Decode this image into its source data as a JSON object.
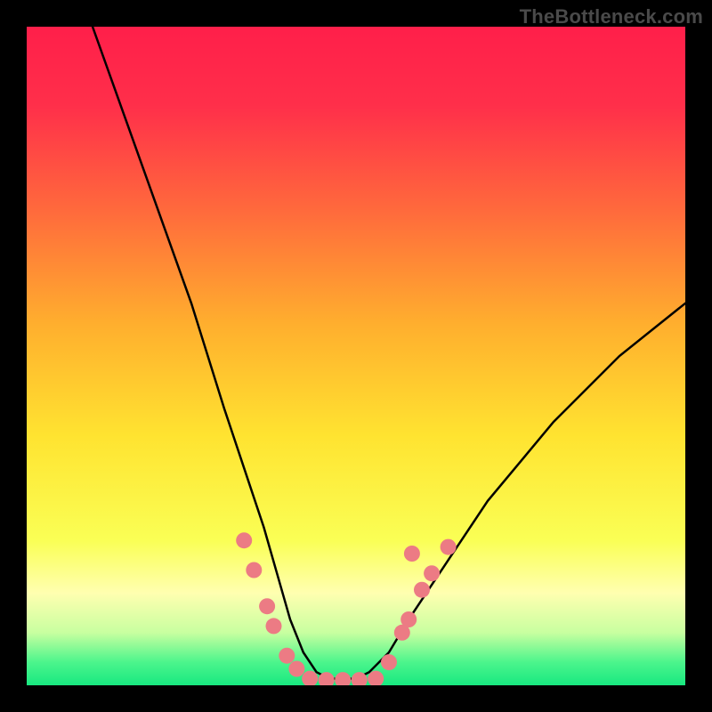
{
  "watermark": "TheBottleneck.com",
  "gradient": {
    "stops": [
      {
        "offset": 0.0,
        "color": "#ff1f4a"
      },
      {
        "offset": 0.12,
        "color": "#ff2f4a"
      },
      {
        "offset": 0.28,
        "color": "#ff6a3c"
      },
      {
        "offset": 0.45,
        "color": "#ffae2e"
      },
      {
        "offset": 0.62,
        "color": "#ffe330"
      },
      {
        "offset": 0.78,
        "color": "#faff55"
      },
      {
        "offset": 0.86,
        "color": "#ffffb0"
      },
      {
        "offset": 0.92,
        "color": "#c8ffa0"
      },
      {
        "offset": 0.965,
        "color": "#4cf58c"
      },
      {
        "offset": 1.0,
        "color": "#18e880"
      }
    ]
  },
  "chart_data": {
    "type": "line",
    "title": "",
    "xlabel": "",
    "ylabel": "",
    "xlim": [
      0,
      100
    ],
    "ylim": [
      0,
      100
    ],
    "series": [
      {
        "name": "bottleneck-curve",
        "x": [
          10,
          15,
          20,
          25,
          30,
          33,
          36,
          38,
          40,
          42,
          44,
          46,
          48,
          50,
          52,
          55,
          58,
          62,
          66,
          70,
          75,
          80,
          85,
          90,
          95,
          100
        ],
        "y": [
          100,
          86,
          72,
          58,
          42,
          33,
          24,
          17,
          10,
          5,
          2,
          1,
          1,
          1,
          2,
          5,
          10,
          16,
          22,
          28,
          34,
          40,
          45,
          50,
          54,
          58
        ]
      }
    ],
    "markers": {
      "name": "highlight-dots",
      "color": "#ec7b84",
      "radius": 9,
      "points": [
        {
          "x": 33.0,
          "y": 22.0
        },
        {
          "x": 34.5,
          "y": 17.5
        },
        {
          "x": 36.5,
          "y": 12.0
        },
        {
          "x": 37.5,
          "y": 9.0
        },
        {
          "x": 39.5,
          "y": 4.5
        },
        {
          "x": 41.0,
          "y": 2.5
        },
        {
          "x": 43.0,
          "y": 1.0
        },
        {
          "x": 45.5,
          "y": 0.8
        },
        {
          "x": 48.0,
          "y": 0.8
        },
        {
          "x": 50.5,
          "y": 0.8
        },
        {
          "x": 53.0,
          "y": 1.0
        },
        {
          "x": 55.0,
          "y": 3.5
        },
        {
          "x": 57.0,
          "y": 8.0
        },
        {
          "x": 58.0,
          "y": 10.0
        },
        {
          "x": 60.0,
          "y": 14.5
        },
        {
          "x": 61.5,
          "y": 17.0
        },
        {
          "x": 64.0,
          "y": 21.0
        },
        {
          "x": 58.5,
          "y": 20.0
        }
      ]
    }
  }
}
